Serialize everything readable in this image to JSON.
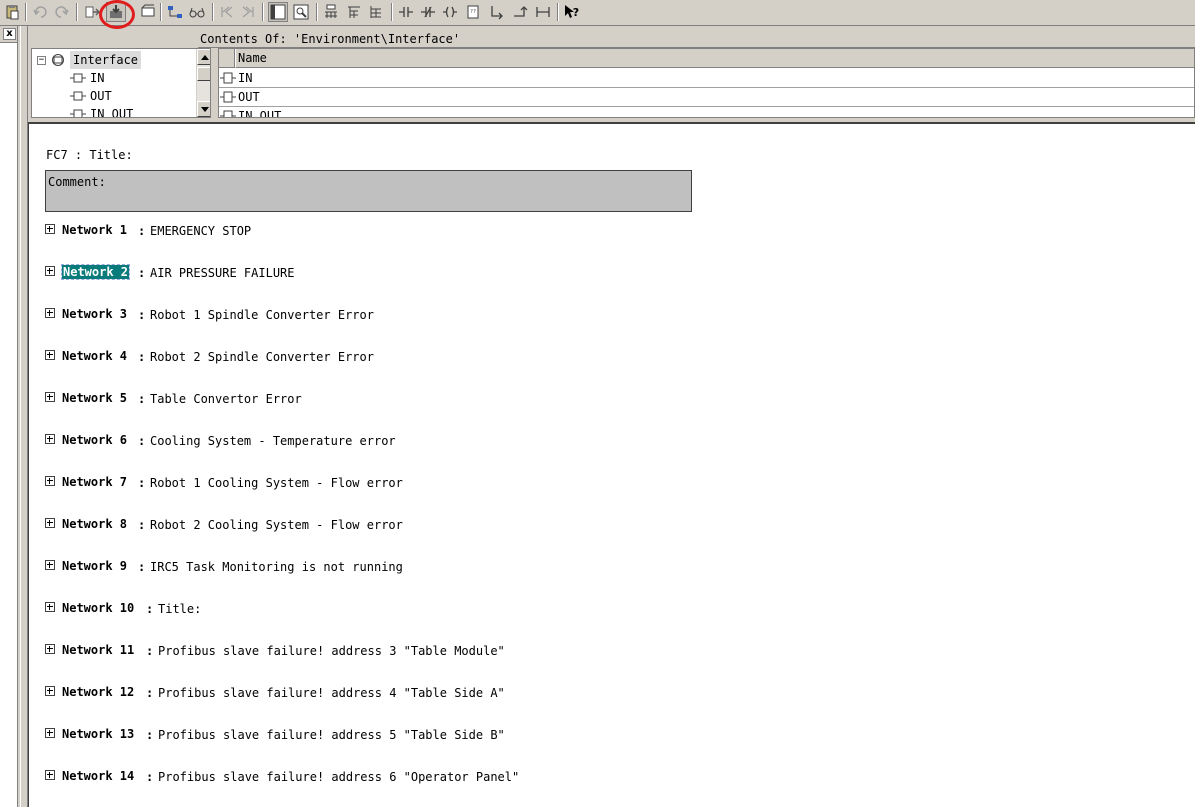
{
  "colors": {
    "selection": "#0a7b7b",
    "highlight_ring": "#e01c1c",
    "chrome": "#d4d0c8"
  },
  "toolbar": {
    "buttons": [
      "paste-icon",
      "undo-icon",
      "redo-icon",
      "load-icon",
      "download-icon",
      "open-block-icon",
      "network-icon",
      "glasses-icon",
      "first-network-icon",
      "next-network-icon",
      "overview-icon",
      "zoom-icon",
      "insert-network-icon",
      "branch-icon",
      "branch-close-icon",
      "contact-no-icon",
      "contact-nc-icon",
      "coil-icon",
      "empty-box-icon",
      "open-branch-icon",
      "close-branch-icon",
      "connection-icon",
      "help-icon"
    ]
  },
  "left_strip": {
    "close_label": "x"
  },
  "interface": {
    "contents_title": "Contents Of: 'Environment\\Interface'",
    "tree": {
      "root": "Interface",
      "expander": "−",
      "children": [
        "IN",
        "OUT",
        "IN_OUT"
      ]
    },
    "list": {
      "header": "Name",
      "rows": [
        "IN",
        "OUT",
        "IN_OUT"
      ]
    }
  },
  "editor": {
    "block_title": "FC7 : Title:",
    "comment_label": "Comment:",
    "networks": [
      {
        "label": "Network 1",
        "sep": ":",
        "title": "EMERGENCY STOP"
      },
      {
        "label": "Network 2",
        "sep": ":",
        "title": "AIR PRESSURE FAILURE"
      },
      {
        "label": "Network 3",
        "sep": ":",
        "title": "Robot 1 Spindle Converter Error"
      },
      {
        "label": "Network 4",
        "sep": ":",
        "title": "Robot 2 Spindle Converter Error"
      },
      {
        "label": "Network 5",
        "sep": ":",
        "title": "Table Convertor Error"
      },
      {
        "label": "Network 6",
        "sep": ":",
        "title": "Cooling System - Temperature error"
      },
      {
        "label": "Network 7",
        "sep": ":",
        "title": "Robot 1 Cooling System - Flow error"
      },
      {
        "label": "Network 8",
        "sep": ":",
        "title": "Robot 2 Cooling System - Flow error"
      },
      {
        "label": "Network 9",
        "sep": ":",
        "title": "IRC5 Task Monitoring is not running"
      },
      {
        "label": "Network 10",
        "sep": ":",
        "title": "Title:"
      },
      {
        "label": "Network 11",
        "sep": ":",
        "title": "Profibus slave failure! address 3 \"Table Module\""
      },
      {
        "label": "Network 12",
        "sep": ":",
        "title": "Profibus slave failure! address 4 \"Table Side A\""
      },
      {
        "label": "Network 13",
        "sep": ":",
        "title": "Profibus slave failure! address 5 \"Table Side B\""
      },
      {
        "label": "Network 14",
        "sep": ":",
        "title": "Profibus slave failure! address 6 \"Operator Panel\""
      }
    ],
    "selected_network": 2
  }
}
